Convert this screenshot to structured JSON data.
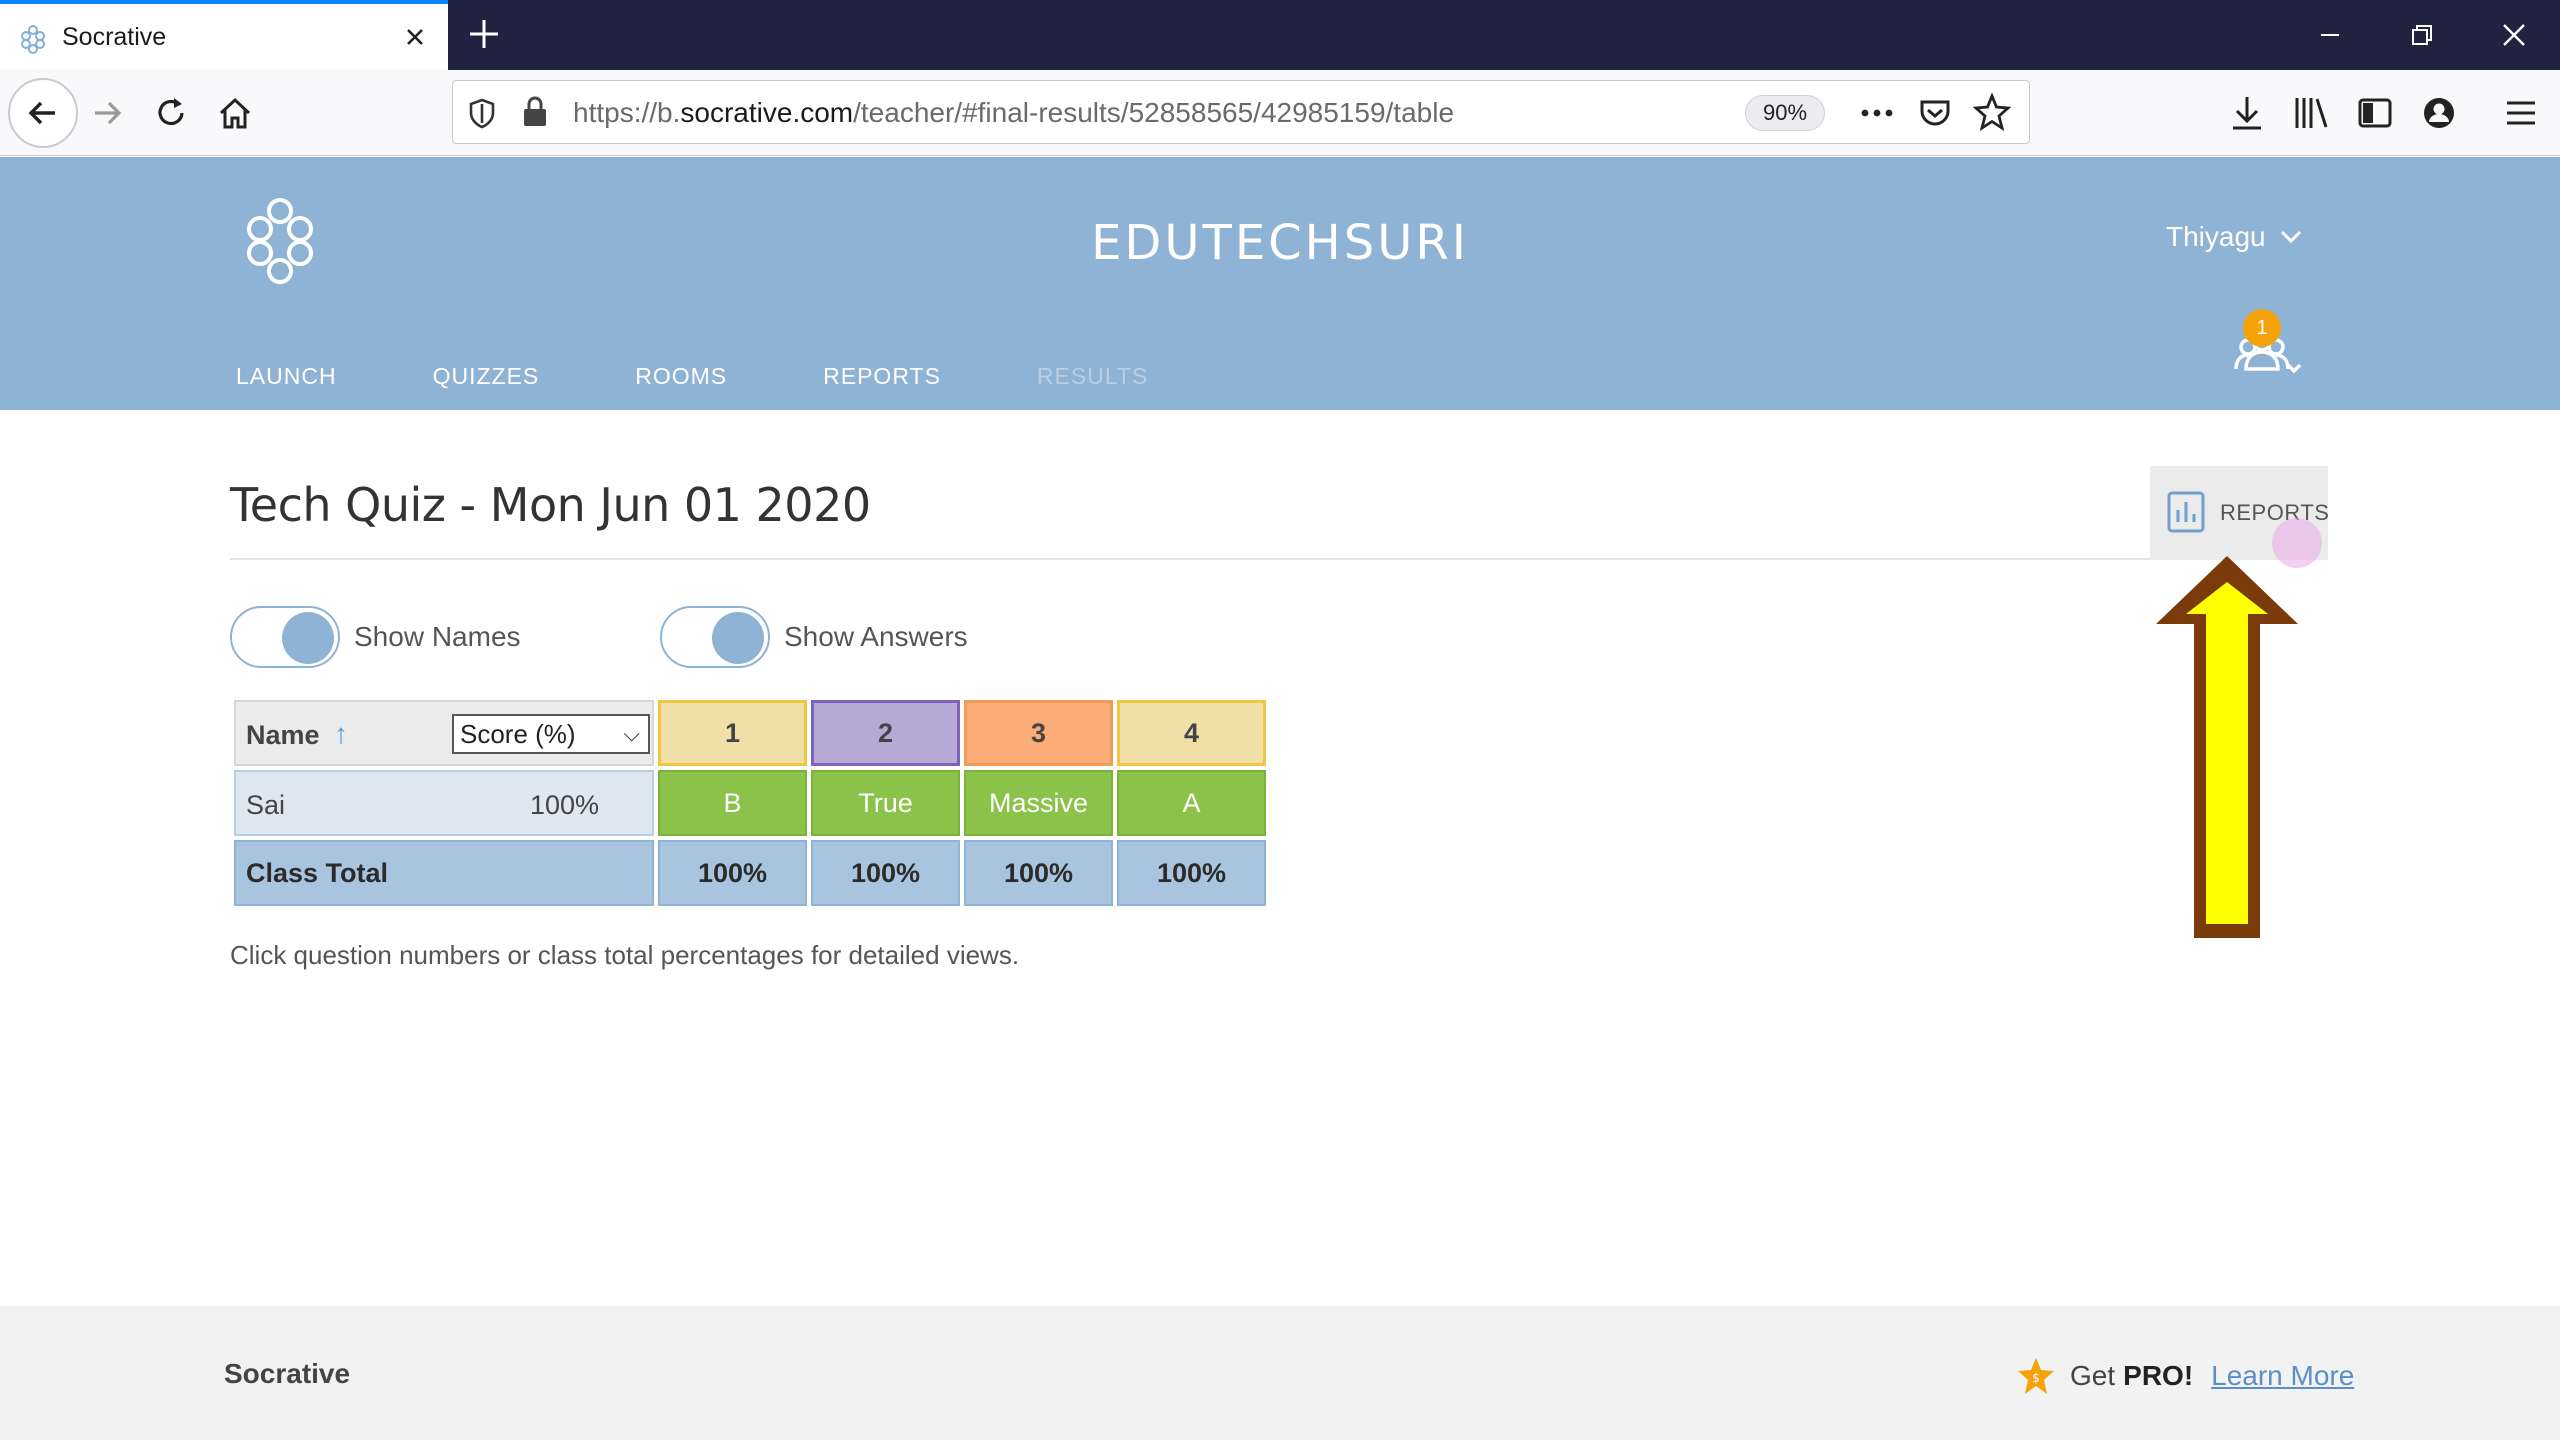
{
  "browser": {
    "tab_title": "Socrative",
    "url_prefix": "https://b.",
    "url_domain": "socrative.com",
    "url_path": "/teacher/#final-results/52858565/42985159/table",
    "zoom": "90%"
  },
  "header": {
    "room_name": "EDUTECHSURI",
    "user_name": "Thiyagu",
    "notification_count": "1",
    "nav": [
      "LAUNCH",
      "QUIZZES",
      "ROOMS",
      "REPORTS",
      "RESULTS"
    ]
  },
  "main": {
    "title": "Tech Quiz - Mon Jun 01 2020",
    "reports_button": "REPORTS",
    "toggles": [
      {
        "label": "Show Names",
        "on": true
      },
      {
        "label": "Show Answers",
        "on": true
      }
    ],
    "table": {
      "name_header": "Name",
      "sort_arrow": "↑",
      "score_select": "Score (%)",
      "questions": [
        "1",
        "2",
        "3",
        "4"
      ],
      "students": [
        {
          "name": "Sai",
          "score": "100%",
          "answers": [
            "B",
            "True",
            "Massive",
            "A"
          ]
        }
      ],
      "total_label": "Class Total",
      "totals": [
        "100%",
        "100%",
        "100%",
        "100%"
      ]
    },
    "hint": "Click question numbers or class total percentages for detailed views."
  },
  "footer": {
    "brand": "Socrative",
    "get_label": "Get",
    "pro_label": "PRO!",
    "learn_more": "Learn More"
  },
  "colors": {
    "header_bg": "#8fb3d4",
    "correct_green": "#8bc24a",
    "q_yellow": "#f1dfa8",
    "q_purple": "#b5a9d6",
    "q_orange": "#fbac77",
    "badge_orange": "#f5a20b",
    "annotation_arrow_fill": "#ffff00",
    "annotation_arrow_border": "#7a3a0a"
  }
}
